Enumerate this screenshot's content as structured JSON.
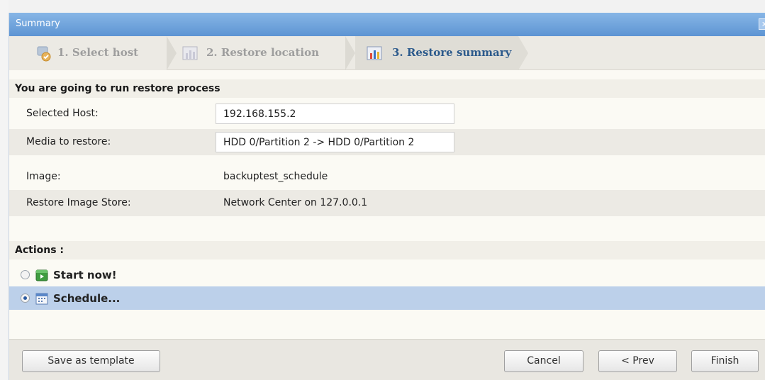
{
  "window": {
    "title": "Summary",
    "close_glyph": "x"
  },
  "wizard": {
    "steps": [
      {
        "label": "1. Select host",
        "icon": "host-icon"
      },
      {
        "label": "2. Restore location",
        "icon": "chart-icon"
      },
      {
        "label": "3. Restore summary",
        "icon": "chart-icon",
        "active": true
      }
    ]
  },
  "summary": {
    "header": "You are going to run restore process",
    "selected_host_label": "Selected Host:",
    "selected_host_value": "192.168.155.2",
    "media_label": "Media to restore:",
    "media_value": "HDD 0/Partition 2 -> HDD 0/Partition 2",
    "image_label": "Image:",
    "image_value": "backuptest_schedule",
    "store_label": "Restore Image Store:",
    "store_value": "Network Center on 127.0.0.1"
  },
  "actions": {
    "header": "Actions :",
    "start_now": "Start now!",
    "schedule": "Schedule...",
    "selected": "schedule"
  },
  "footer": {
    "save_template": "Save as template",
    "cancel": "Cancel",
    "prev": "< Prev",
    "finish": "Finish"
  },
  "colors": {
    "titlebar": "#5d94d3",
    "active_step": "#2c5a8c",
    "selected_row": "#bcd0ea"
  }
}
